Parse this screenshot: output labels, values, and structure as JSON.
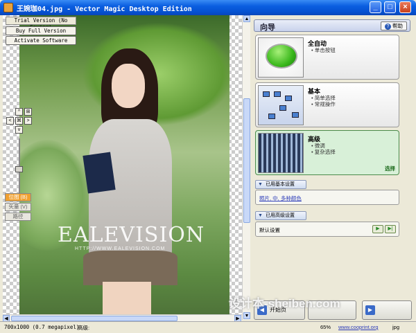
{
  "window": {
    "title": "王婉珈04.jpg - Vector Magic Desktop Edition",
    "controls": {
      "minimize": "_",
      "maximize": "□",
      "close": "×"
    }
  },
  "left_tools": {
    "trial_label": "Trial Version (No Saving)",
    "buy_button": "Buy Full Version",
    "activate_button": "Activate Software",
    "nav": {
      "up": "^",
      "down": "v",
      "left": "<",
      "right": ">",
      "center": "⌘",
      "zoom_in": "⊞",
      "zoom_out": "⊟"
    },
    "view_modes": {
      "original": "位图 (B)",
      "vector": "矢量 (V)",
      "path": "路径"
    }
  },
  "photo": {
    "watermark": "EALEVISION",
    "watermark_sub": "HTTP://WWW.EALEVISION.COM"
  },
  "wizard": {
    "title": "向导",
    "help_label": "帮助",
    "modes": [
      {
        "title": "全自动",
        "bullets": [
          "单击按钮"
        ]
      },
      {
        "title": "基本",
        "bullets": [
          "简单选择",
          "常规操作"
        ]
      },
      {
        "title": "高级",
        "bullets": [
          "微调",
          "复杂选择"
        ],
        "selected_label": "选择"
      }
    ],
    "basic_settings": {
      "header": "已用基本设置",
      "link": "照片, 中, 多种颜色"
    },
    "advanced_settings": {
      "header": "已用高级设置",
      "value": "默认设置",
      "play_icon": "▶",
      "play_to_end_icon": "▶|"
    },
    "nav": {
      "back_label": "开始页",
      "back_icon": "◀",
      "next_icon": "▶"
    },
    "site_watermark": "设计本-sheiben.com"
  },
  "status_bar": {
    "dimensions": "700x1000 (0.7 megapixel)",
    "label": "高级:",
    "zoom": "65%",
    "site": "www.cooprint.org",
    "ext": "jpg"
  },
  "colors": {
    "titlebar": "#0a5ee0",
    "selected_card": "#d8f0d8",
    "view_original_active": "#f0a030"
  }
}
